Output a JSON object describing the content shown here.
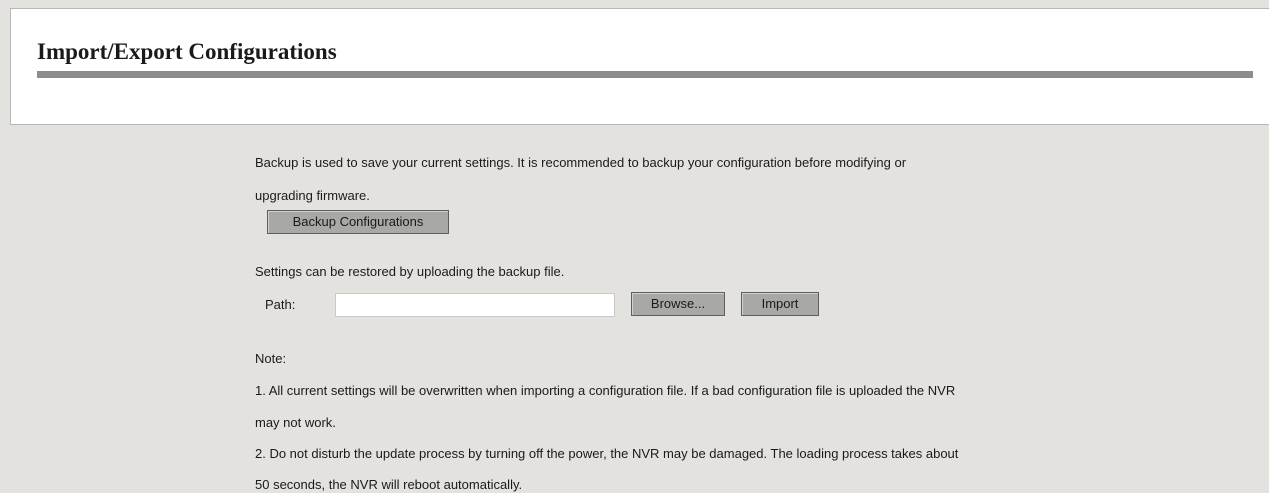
{
  "page": {
    "title": "Import/Export Configurations"
  },
  "backup": {
    "description_line1": "Backup is used to save your current settings. It is recommended to backup your configuration before modifying or",
    "description_line2": "upgrading firmware.",
    "button_label": "Backup Configurations"
  },
  "restore": {
    "description": "Settings can be restored by uploading the backup file.",
    "path_label": "Path:",
    "path_value": "",
    "browse_label": "Browse...",
    "import_label": "Import"
  },
  "notes": {
    "heading": "Note:",
    "line1": "1. All current settings will be overwritten when importing a configuration file. If a bad configuration file is uploaded the NVR",
    "line2": "may not work.",
    "line3": "2. Do not disturb the update process by turning off the power, the NVR may be damaged. The loading process takes about",
    "line4": "50 seconds, the NVR will reboot automatically."
  },
  "colors": {
    "background": "#e3e2de",
    "header_background": "#ffffff",
    "title_rule": "#8c8c8c",
    "button_face": "#a8a8a6"
  }
}
